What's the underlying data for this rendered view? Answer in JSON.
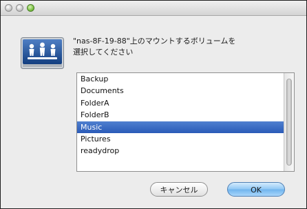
{
  "window": {
    "controls": [
      "close-button",
      "minimize-button",
      "zoom-button"
    ]
  },
  "dialog": {
    "prompt": "\"nas-8F-19-88\"上のマウントするボリュームを\n選択してください",
    "icon": "network-drive-icon"
  },
  "volumes": {
    "items": [
      "Backup",
      "Documents",
      "FolderA",
      "FolderB",
      "Music",
      "Pictures",
      "readydrop"
    ],
    "selected": "Music"
  },
  "buttons": {
    "cancel_label": "キャンセル",
    "ok_label": "OK"
  },
  "colors": {
    "selection": "#2a5bb8",
    "default_button": "#6fb4ee",
    "icon_plate": "#1b4a8c"
  }
}
